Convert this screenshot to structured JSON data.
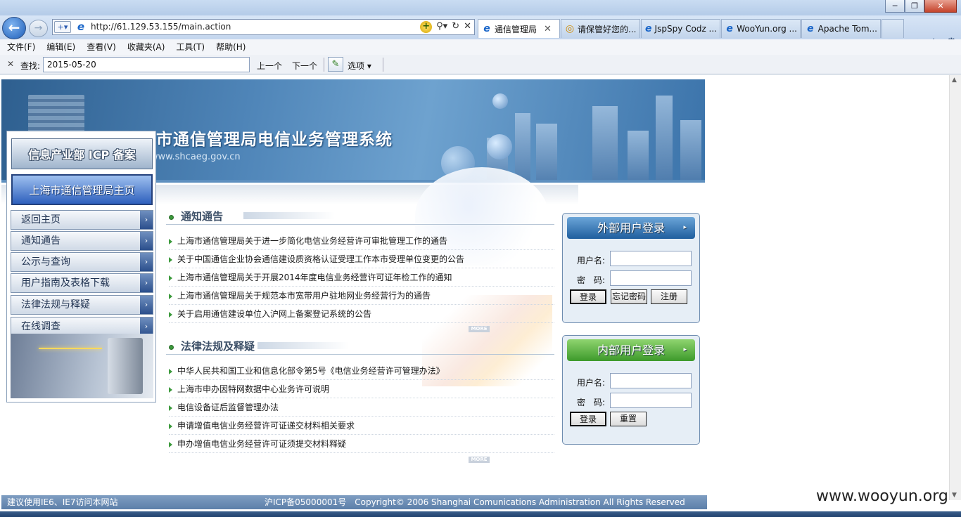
{
  "browser": {
    "address_url": "http://61.129.53.155/main.action",
    "tabs": [
      {
        "label": "通信管理局",
        "active": true
      },
      {
        "label": "请保管好您的...",
        "active": false
      },
      {
        "label": "JspSpy Codz ...",
        "active": false
      },
      {
        "label": "WooYun.org ...",
        "active": false
      },
      {
        "label": "Apache Tom...",
        "active": false
      }
    ],
    "tab_close": "✕",
    "menu": [
      "文件(F)",
      "编辑(E)",
      "查看(V)",
      "收藏夹(A)",
      "工具(T)",
      "帮助(H)"
    ],
    "find": {
      "label": "查找:",
      "value": "2015-05-20",
      "prev": "上一个",
      "next": "下一个",
      "options": "选项 ▾"
    },
    "window_buttons": {
      "min": "─",
      "max": "❐",
      "close": "✕"
    }
  },
  "banner": {
    "title": "上海市通信管理局电信业务管理系统",
    "url": "http://www.shcaeg.gov.cn"
  },
  "sidebar": {
    "icp_button": "信息产业部 ICP 备案",
    "home_button": "上海市通信管理局主页",
    "items": [
      "返回主页",
      "通知通告",
      "公示与查询",
      "用户指南及表格下载",
      "法律法规与释疑",
      "在线调查"
    ]
  },
  "notices": {
    "title": "通知通告",
    "items": [
      "上海市通信管理局关于进一步简化电信业务经营许可审批管理工作的通告",
      "关于中国通信企业协会通信建设质资格认证受理工作本市受理单位变更的公告",
      "上海市通信管理局关于开展2014年度电信业务经营许可证年检工作的通知",
      "上海市通信管理局关于规范本市宽带用户驻地网业务经营行为的通告",
      "关于启用通信建设单位入沪网上备案登记系统的公告"
    ],
    "more": "MORE"
  },
  "laws": {
    "title": "法律法规及释疑",
    "items": [
      "中华人民共和国工业和信息化部令第5号《电信业务经营许可管理办法》",
      "上海市申办因特网数据中心业务许可说明",
      "电信设备证后监督管理办法",
      "申请增值电信业务经营许可证递交材料相关要求",
      "申办增值电信业务经营许可证须提交材料释疑"
    ],
    "more": "MORE"
  },
  "external_login": {
    "title": "外部用户登录",
    "username_label": "用户名:",
    "password_label": "密　码:",
    "login": "登录",
    "forgot": "忘记密码",
    "register": "注册"
  },
  "internal_login": {
    "title": "内部用户登录",
    "username_label": "用户名:",
    "password_label": "密　码:",
    "login": "登录",
    "reset": "重置"
  },
  "footer": {
    "left": "建议使用IE6、IE7访问本网站",
    "right": "沪ICP备05000001号　Copyright© 2006 Shanghai Comunications Administration All Rights Reserved"
  },
  "watermark": "www.wooyun.org",
  "colors": {
    "banner": "#4f85b8",
    "green_bullet": "#3c9a3c",
    "footer": "#6b8cb4"
  }
}
